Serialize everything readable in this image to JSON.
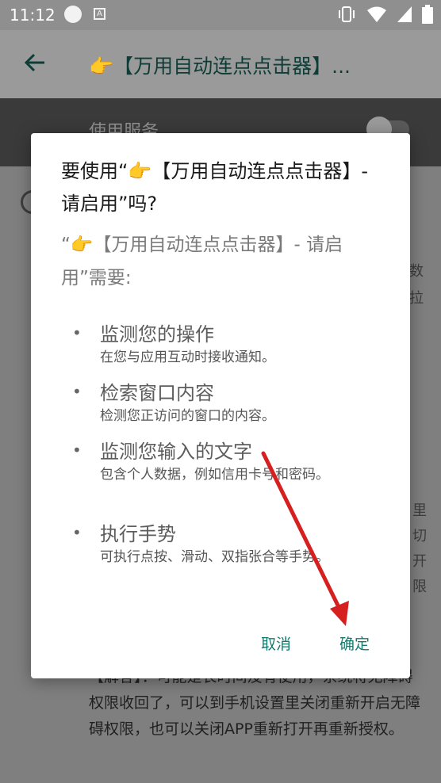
{
  "status_bar": {
    "time": "11:12",
    "a_icon": "A"
  },
  "app_bar": {
    "back_icon": "arrow-left",
    "title": "👉【万用自动连点点击器】..."
  },
  "service": {
    "label": "使用服务",
    "toggle_on": false
  },
  "background": {
    "side_chars_right": [
      "数",
      "拉",
      "里",
      "切",
      "开",
      "限"
    ],
    "bottom_text": "【解答】：可能是长时间没有使用，系统将无障碍权限收回了，可以到手机设置里关闭重新开启无障碍权限，也可以关闭APP重新打开再重新授权。"
  },
  "dialog": {
    "title": "要使用“👉【万用自动连点点击器】- 请启用”吗?",
    "subtitle": "“👉【万用自动连点点击器】- 请启用”需要:",
    "permissions": [
      {
        "bullet": "•",
        "title": "监测您的操作",
        "desc": "在您与应用互动时接收通知。"
      },
      {
        "bullet": "•",
        "title": "检索窗口内容",
        "desc": "检测您正访问的窗口的内容。"
      },
      {
        "bullet": "•",
        "title": "监测您输入的文字",
        "desc": "包含个人数据，例如信用卡号和密码。"
      },
      {
        "bullet": "•",
        "title": "执行手势",
        "desc": "可执行点按、滑动、双指张合等手势。"
      }
    ],
    "cancel_label": "取消",
    "confirm_label": "确定"
  },
  "colors": {
    "accent": "#137a6e",
    "annotation_arrow": "#d62020"
  }
}
